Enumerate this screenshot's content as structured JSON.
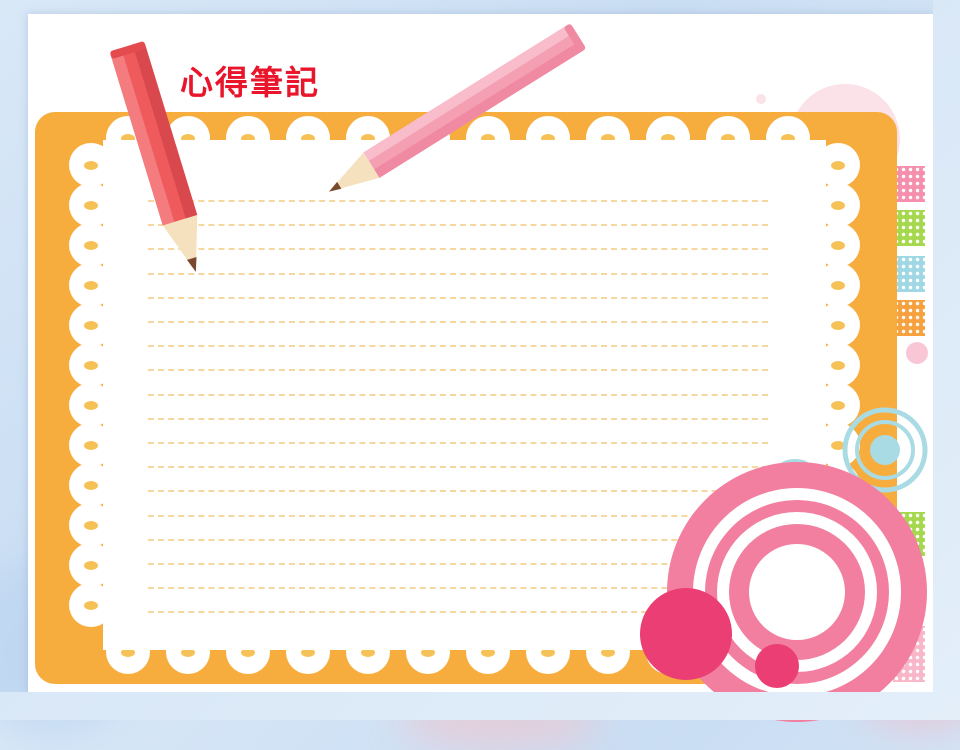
{
  "title": "心得筆記",
  "colors": {
    "frame": "#f6ad3e",
    "title": "#e8152b",
    "pencil_red": "#ef5a5d",
    "pencil_pink": "#f59fb3",
    "circle_pink": "#f27fa0",
    "circle_magenta": "#ea3e74",
    "ruled_line": "#f5d8a0"
  },
  "decorations": {
    "pencils": [
      "red-pencil",
      "pink-pencil"
    ],
    "tabs": [
      "pink-dotted",
      "green-dotted",
      "blue-dotted",
      "orange-dotted"
    ],
    "circles": [
      "pink-concentric-circles",
      "teal-concentric-circles"
    ]
  },
  "ruled_line_count": 18
}
